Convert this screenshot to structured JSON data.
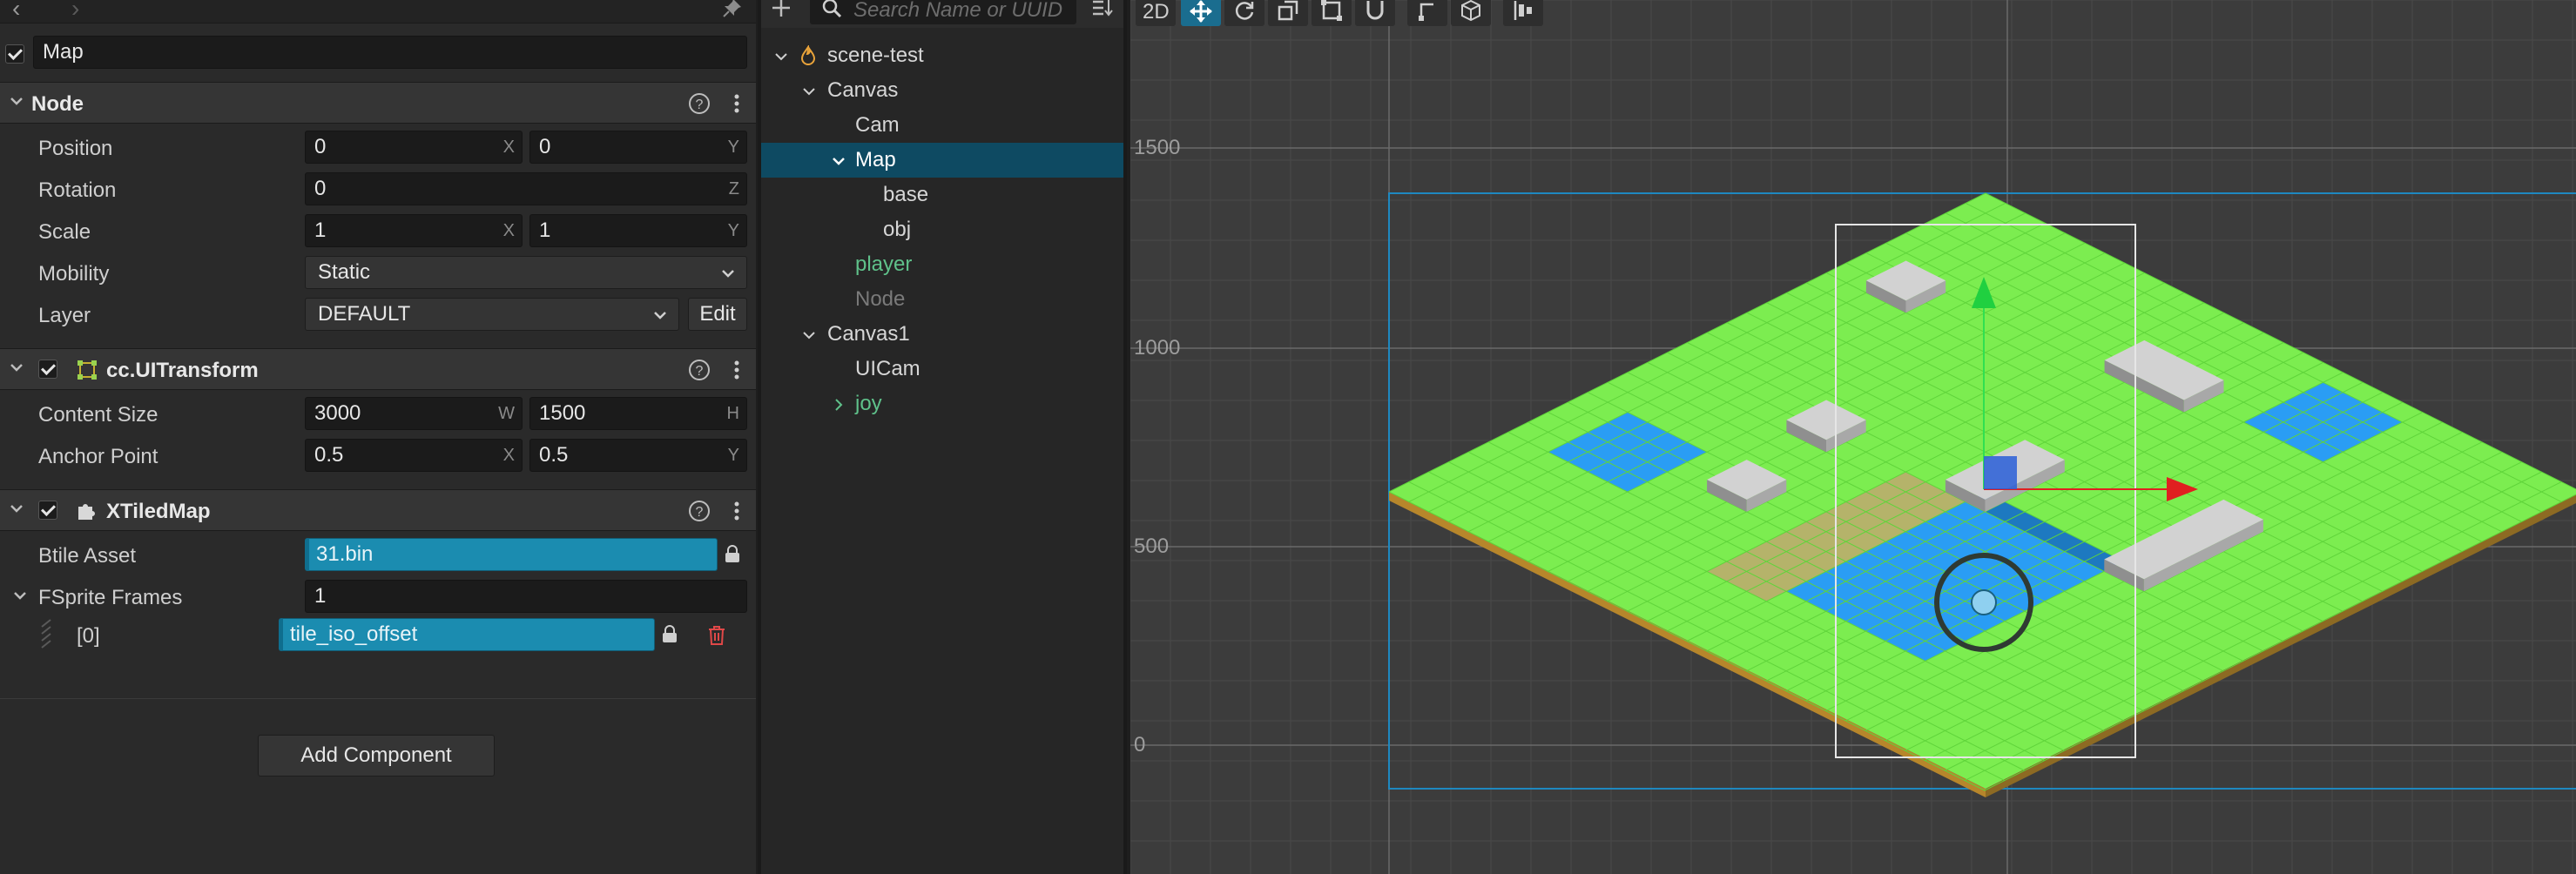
{
  "inspector": {
    "node_name": "Map",
    "node_section": {
      "title": "Node",
      "position": {
        "label": "Position",
        "x": "0",
        "y": "0"
      },
      "rotation": {
        "label": "Rotation",
        "z": "0"
      },
      "scale": {
        "label": "Scale",
        "x": "1",
        "y": "1"
      },
      "mobility": {
        "label": "Mobility",
        "value": "Static"
      },
      "layer": {
        "label": "Layer",
        "value": "DEFAULT",
        "edit_label": "Edit"
      }
    },
    "ui_transform": {
      "title": "cc.UITransform",
      "content_size": {
        "label": "Content Size",
        "w": "3000",
        "h": "1500"
      },
      "anchor_point": {
        "label": "Anchor Point",
        "x": "0.5",
        "y": "0.5"
      }
    },
    "xtiled_map": {
      "title": "XTiledMap",
      "btile_asset": {
        "label": "Btile Asset",
        "value": "31.bin"
      },
      "fsprite_frames": {
        "label": "FSprite Frames",
        "count": "1"
      },
      "frame_0": {
        "index_label": "[0]",
        "value": "tile_iso_offset"
      }
    },
    "suffixes": {
      "x": "X",
      "y": "Y",
      "z": "Z",
      "w": "W",
      "h": "H"
    },
    "add_component_label": "Add Component"
  },
  "hierarchy": {
    "search_placeholder": "Search Name or UUID",
    "tree": [
      {
        "label": "scene-test",
        "kind": "scene"
      },
      {
        "label": "Canvas",
        "kind": "node"
      },
      {
        "label": "Cam",
        "kind": "node"
      },
      {
        "label": "Map",
        "kind": "node",
        "selected": true
      },
      {
        "label": "base",
        "kind": "node"
      },
      {
        "label": "obj",
        "kind": "node"
      },
      {
        "label": "player",
        "kind": "prefab"
      },
      {
        "label": "Node",
        "kind": "inactive"
      },
      {
        "label": "Canvas1",
        "kind": "node"
      },
      {
        "label": "UICam",
        "kind": "node"
      },
      {
        "label": "joy",
        "kind": "prefab"
      }
    ]
  },
  "scene": {
    "mode_2d_label": "2D",
    "axis_labels": [
      "1500",
      "1000",
      "500",
      "0"
    ],
    "colors": {
      "grass": "#7ced50",
      "water": "#2a9df4",
      "dirt": "#b7862b",
      "gizmo_x": "#e02020",
      "gizmo_y": "#20d040",
      "selection": "#1e88c0"
    }
  }
}
